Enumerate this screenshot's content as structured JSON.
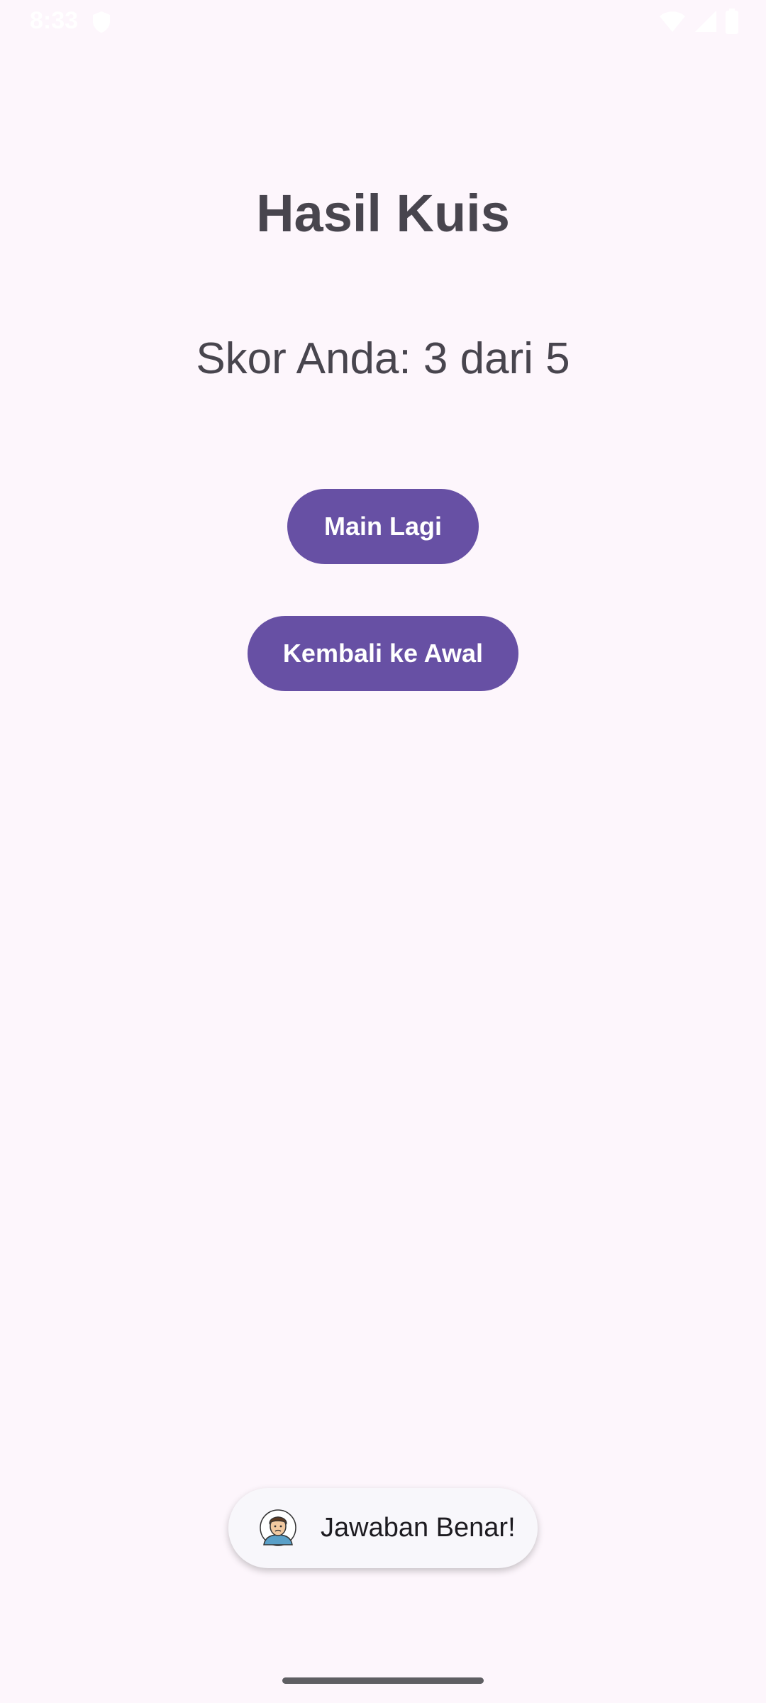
{
  "status_bar": {
    "time": "8:33",
    "icons": [
      "shield-icon",
      "wifi-icon",
      "signal-icon",
      "battery-icon"
    ]
  },
  "screen": {
    "title": "Hasil Kuis",
    "score": "Skor Anda: 3 dari 5"
  },
  "buttons": {
    "replay_label": "Main Lagi",
    "home_label": "Kembali ke Awal"
  },
  "toast": {
    "message": "Jawaban Benar!",
    "icon": "app-avatar-icon"
  },
  "colors": {
    "background": "#fdf6fc",
    "primary": "#6750a4",
    "text": "#48454e"
  }
}
